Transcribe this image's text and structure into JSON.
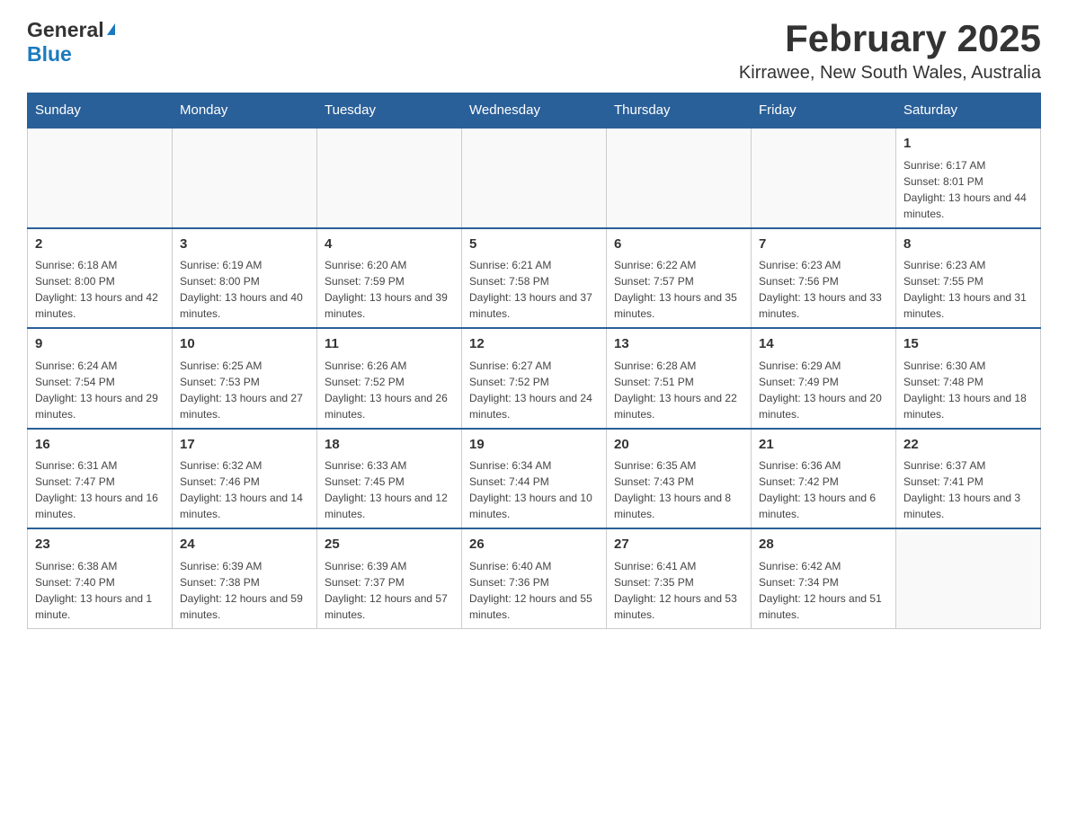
{
  "header": {
    "logo_general": "General",
    "logo_blue": "Blue",
    "title": "February 2025",
    "subtitle": "Kirrawee, New South Wales, Australia"
  },
  "weekdays": [
    "Sunday",
    "Monday",
    "Tuesday",
    "Wednesday",
    "Thursday",
    "Friday",
    "Saturday"
  ],
  "weeks": [
    {
      "days": [
        {
          "number": "",
          "info": ""
        },
        {
          "number": "",
          "info": ""
        },
        {
          "number": "",
          "info": ""
        },
        {
          "number": "",
          "info": ""
        },
        {
          "number": "",
          "info": ""
        },
        {
          "number": "",
          "info": ""
        },
        {
          "number": "1",
          "info": "Sunrise: 6:17 AM\nSunset: 8:01 PM\nDaylight: 13 hours and 44 minutes."
        }
      ]
    },
    {
      "days": [
        {
          "number": "2",
          "info": "Sunrise: 6:18 AM\nSunset: 8:00 PM\nDaylight: 13 hours and 42 minutes."
        },
        {
          "number": "3",
          "info": "Sunrise: 6:19 AM\nSunset: 8:00 PM\nDaylight: 13 hours and 40 minutes."
        },
        {
          "number": "4",
          "info": "Sunrise: 6:20 AM\nSunset: 7:59 PM\nDaylight: 13 hours and 39 minutes."
        },
        {
          "number": "5",
          "info": "Sunrise: 6:21 AM\nSunset: 7:58 PM\nDaylight: 13 hours and 37 minutes."
        },
        {
          "number": "6",
          "info": "Sunrise: 6:22 AM\nSunset: 7:57 PM\nDaylight: 13 hours and 35 minutes."
        },
        {
          "number": "7",
          "info": "Sunrise: 6:23 AM\nSunset: 7:56 PM\nDaylight: 13 hours and 33 minutes."
        },
        {
          "number": "8",
          "info": "Sunrise: 6:23 AM\nSunset: 7:55 PM\nDaylight: 13 hours and 31 minutes."
        }
      ]
    },
    {
      "days": [
        {
          "number": "9",
          "info": "Sunrise: 6:24 AM\nSunset: 7:54 PM\nDaylight: 13 hours and 29 minutes."
        },
        {
          "number": "10",
          "info": "Sunrise: 6:25 AM\nSunset: 7:53 PM\nDaylight: 13 hours and 27 minutes."
        },
        {
          "number": "11",
          "info": "Sunrise: 6:26 AM\nSunset: 7:52 PM\nDaylight: 13 hours and 26 minutes."
        },
        {
          "number": "12",
          "info": "Sunrise: 6:27 AM\nSunset: 7:52 PM\nDaylight: 13 hours and 24 minutes."
        },
        {
          "number": "13",
          "info": "Sunrise: 6:28 AM\nSunset: 7:51 PM\nDaylight: 13 hours and 22 minutes."
        },
        {
          "number": "14",
          "info": "Sunrise: 6:29 AM\nSunset: 7:49 PM\nDaylight: 13 hours and 20 minutes."
        },
        {
          "number": "15",
          "info": "Sunrise: 6:30 AM\nSunset: 7:48 PM\nDaylight: 13 hours and 18 minutes."
        }
      ]
    },
    {
      "days": [
        {
          "number": "16",
          "info": "Sunrise: 6:31 AM\nSunset: 7:47 PM\nDaylight: 13 hours and 16 minutes."
        },
        {
          "number": "17",
          "info": "Sunrise: 6:32 AM\nSunset: 7:46 PM\nDaylight: 13 hours and 14 minutes."
        },
        {
          "number": "18",
          "info": "Sunrise: 6:33 AM\nSunset: 7:45 PM\nDaylight: 13 hours and 12 minutes."
        },
        {
          "number": "19",
          "info": "Sunrise: 6:34 AM\nSunset: 7:44 PM\nDaylight: 13 hours and 10 minutes."
        },
        {
          "number": "20",
          "info": "Sunrise: 6:35 AM\nSunset: 7:43 PM\nDaylight: 13 hours and 8 minutes."
        },
        {
          "number": "21",
          "info": "Sunrise: 6:36 AM\nSunset: 7:42 PM\nDaylight: 13 hours and 6 minutes."
        },
        {
          "number": "22",
          "info": "Sunrise: 6:37 AM\nSunset: 7:41 PM\nDaylight: 13 hours and 3 minutes."
        }
      ]
    },
    {
      "days": [
        {
          "number": "23",
          "info": "Sunrise: 6:38 AM\nSunset: 7:40 PM\nDaylight: 13 hours and 1 minute."
        },
        {
          "number": "24",
          "info": "Sunrise: 6:39 AM\nSunset: 7:38 PM\nDaylight: 12 hours and 59 minutes."
        },
        {
          "number": "25",
          "info": "Sunrise: 6:39 AM\nSunset: 7:37 PM\nDaylight: 12 hours and 57 minutes."
        },
        {
          "number": "26",
          "info": "Sunrise: 6:40 AM\nSunset: 7:36 PM\nDaylight: 12 hours and 55 minutes."
        },
        {
          "number": "27",
          "info": "Sunrise: 6:41 AM\nSunset: 7:35 PM\nDaylight: 12 hours and 53 minutes."
        },
        {
          "number": "28",
          "info": "Sunrise: 6:42 AM\nSunset: 7:34 PM\nDaylight: 12 hours and 51 minutes."
        },
        {
          "number": "",
          "info": ""
        }
      ]
    }
  ]
}
